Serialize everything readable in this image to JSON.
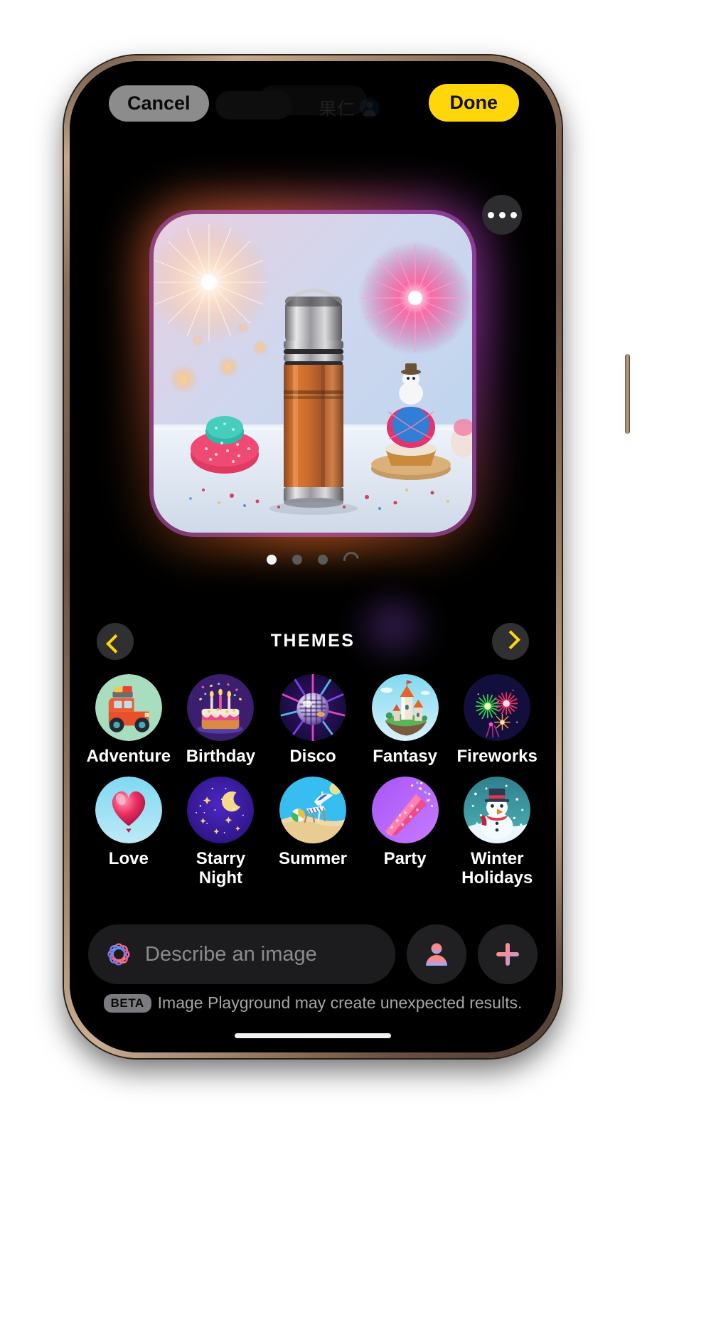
{
  "topbar": {
    "cancel_label": "Cancel",
    "done_label": "Done",
    "watermark_text": "果仁",
    "watermark_icon": "person-badge-icon"
  },
  "hero": {
    "more_icon": "ellipsis-icon",
    "description": "Generated image: copper thermos flask on snowy table with fireworks, a snowman cupcake and a pink pompom cupcake",
    "glow_colors": [
      "#ff6e3c",
      "#c846dc",
      "#ff7828"
    ]
  },
  "pagination": {
    "dots": [
      {
        "state": "active"
      },
      {
        "state": "inactive"
      },
      {
        "state": "inactive"
      }
    ],
    "loading_indicator": "spinner-icon"
  },
  "themes": {
    "title": "THEMES",
    "prev_icon": "chevron-left-icon",
    "next_icon": "chevron-right-icon",
    "accent_color": "#ffd60a",
    "items": [
      {
        "label": "Adventure",
        "icon": "jeep-icon",
        "bg": "#a9ddbf"
      },
      {
        "label": "Birthday",
        "icon": "birthday-cake-icon",
        "bg": "#3b1e6e"
      },
      {
        "label": "Disco",
        "icon": "disco-ball-icon",
        "bg": "#1b0d3f"
      },
      {
        "label": "Fantasy",
        "icon": "castle-icon",
        "bg": "#5fc8e8"
      },
      {
        "label": "Fireworks",
        "icon": "fireworks-icon",
        "bg": "#100f3a"
      },
      {
        "label": "Love",
        "icon": "heart-balloon-icon",
        "bg": "#7fd4ee"
      },
      {
        "label": "Starry Night",
        "icon": "moon-stars-icon",
        "bg": "#3a1b9e"
      },
      {
        "label": "Summer",
        "icon": "beach-chair-icon",
        "bg": "#38bdf0"
      },
      {
        "label": "Party",
        "icon": "party-popper-icon",
        "bg": "#a855f7"
      },
      {
        "label": "Winter Holidays",
        "icon": "snowman-icon",
        "bg": "#2b6f7a"
      }
    ]
  },
  "bottombar": {
    "prompt_placeholder": "Describe an image",
    "ai_icon": "apple-intelligence-ring-icon",
    "person_button_icon": "person-icon",
    "add_button_icon": "plus-icon"
  },
  "footer": {
    "beta_badge": "BETA",
    "disclaimer": "Image Playground may create unexpected results."
  }
}
